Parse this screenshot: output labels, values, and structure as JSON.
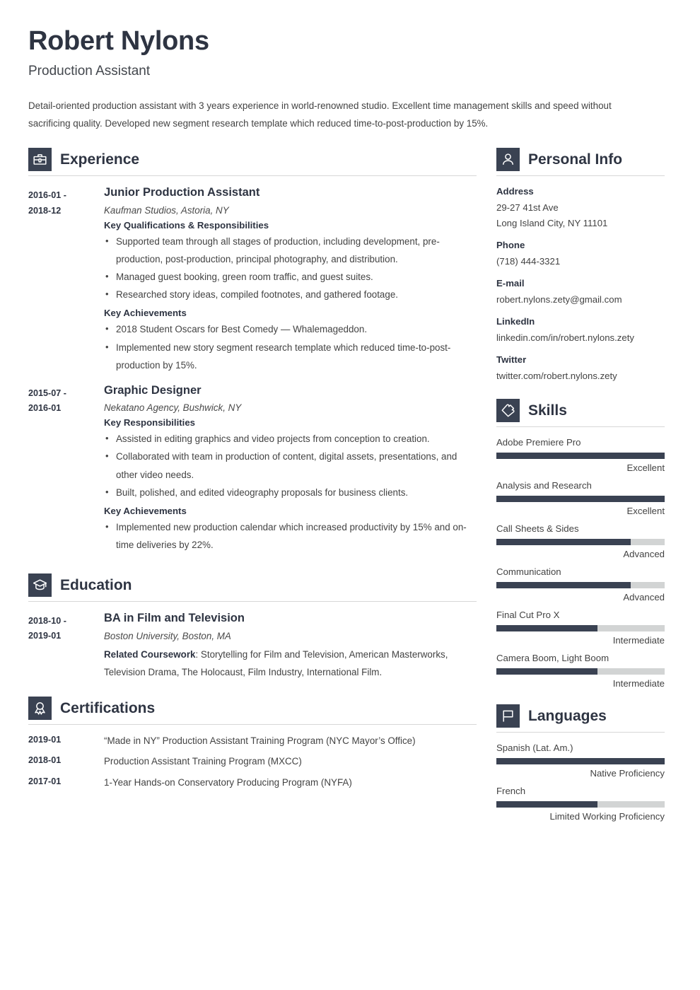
{
  "header": {
    "name": "Robert Nylons",
    "job_title": "Production Assistant",
    "summary": "Detail-oriented production assistant with 3 years experience in world-renowned studio. Excellent time management skills and speed without sacrificing quality. Developed new segment research template which reduced time-to-post-production by 15%."
  },
  "theme": {
    "accent_dark": "#3a4252",
    "heading_color": "#2e3442",
    "bar_track": "#d2d4d4",
    "rule_color": "#d7d7d7"
  },
  "experience": {
    "title": "Experience",
    "icon": "briefcase-icon",
    "entries": [
      {
        "date": "2016-01 - 2018-12",
        "title": "Junior Production Assistant",
        "company": "Kaufman Studios, Astoria, NY",
        "groups": [
          {
            "label": "Key Qualifications & Responsibilities",
            "bullets": [
              "Supported team through all stages of production, including development, pre-production, post-production, principal photography, and distribution.",
              "Managed guest booking, green room traffic, and guest suites.",
              "Researched story ideas, compiled footnotes, and gathered footage."
            ]
          },
          {
            "label": "Key Achievements",
            "bullets": [
              "2018 Student Oscars for Best Comedy — Whalemageddon.",
              "Implemented new story segment research template which reduced time-to-post-production by 15%."
            ]
          }
        ]
      },
      {
        "date": "2015-07 - 2016-01",
        "title": "Graphic Designer",
        "company": "Nekatano Agency, Bushwick, NY",
        "groups": [
          {
            "label": "Key Responsibilities",
            "bullets": [
              "Assisted in editing graphics and video projects from conception to creation.",
              "Collaborated with team in production of content, digital assets, presentations, and other video needs.",
              "Built, polished, and edited videography proposals for business clients."
            ]
          },
          {
            "label": "Key Achievements",
            "bullets": [
              "Implemented new production calendar which increased productivity by 15% and on-time deliveries by 22%."
            ]
          }
        ]
      }
    ]
  },
  "education": {
    "title": "Education",
    "icon": "graduation-cap-icon",
    "entry": {
      "date": "2018-10 - 2019-01",
      "degree": "BA in Film and Television",
      "school": "Boston University, Boston, MA",
      "coursework_label": "Related Coursework",
      "coursework_text": ": Storytelling for Film and Television, American Masterworks, Television Drama, The Holocaust, Film Industry, International Film."
    }
  },
  "certifications": {
    "title": "Certifications",
    "icon": "award-ribbon-icon",
    "rows": [
      {
        "date": "2019-01",
        "text": "“Made in NY” Production Assistant Training Program (NYC Mayor’s Office)"
      },
      {
        "date": "2018-01",
        "text": "Production Assistant Training Program (MXCC)"
      },
      {
        "date": "2017-01",
        "text": "1-Year Hands-on Conservatory Producing Program (NYFA)"
      }
    ]
  },
  "personal_info": {
    "title": "Personal Info",
    "icon": "person-icon",
    "blocks": [
      {
        "label": "Address",
        "value": "29-27 41st Ave\nLong Island City, NY 11101",
        "line1": "29-27 41st Ave",
        "line2": "Long Island City, NY 11101"
      },
      {
        "label": "Phone",
        "value": "(718) 444-3321"
      },
      {
        "label": "E-mail",
        "value": "robert.nylons.zety@gmail.com"
      },
      {
        "label": "LinkedIn",
        "value": "linkedin.com/in/robert.nylons.zety"
      },
      {
        "label": "Twitter",
        "value": "twitter.com/robert.nylons.zety"
      }
    ]
  },
  "skills": {
    "title": "Skills",
    "icon": "puzzle-piece-icon",
    "items": [
      {
        "name": "Adobe Premiere Pro",
        "level": "Excellent",
        "percent": 100
      },
      {
        "name": "Analysis and Research",
        "level": "Excellent",
        "percent": 100
      },
      {
        "name": "Call Sheets & Sides",
        "level": "Advanced",
        "percent": 80
      },
      {
        "name": "Communication",
        "level": "Advanced",
        "percent": 80
      },
      {
        "name": "Final Cut Pro X",
        "level": "Intermediate",
        "percent": 60
      },
      {
        "name": "Camera Boom, Light Boom",
        "level": "Intermediate",
        "percent": 60
      }
    ]
  },
  "languages": {
    "title": "Languages",
    "icon": "flag-icon",
    "items": [
      {
        "name": "Spanish (Lat. Am.)",
        "level": "Native Proficiency",
        "percent": 100
      },
      {
        "name": "French",
        "level": "Limited Working Proficiency",
        "percent": 60
      }
    ]
  }
}
